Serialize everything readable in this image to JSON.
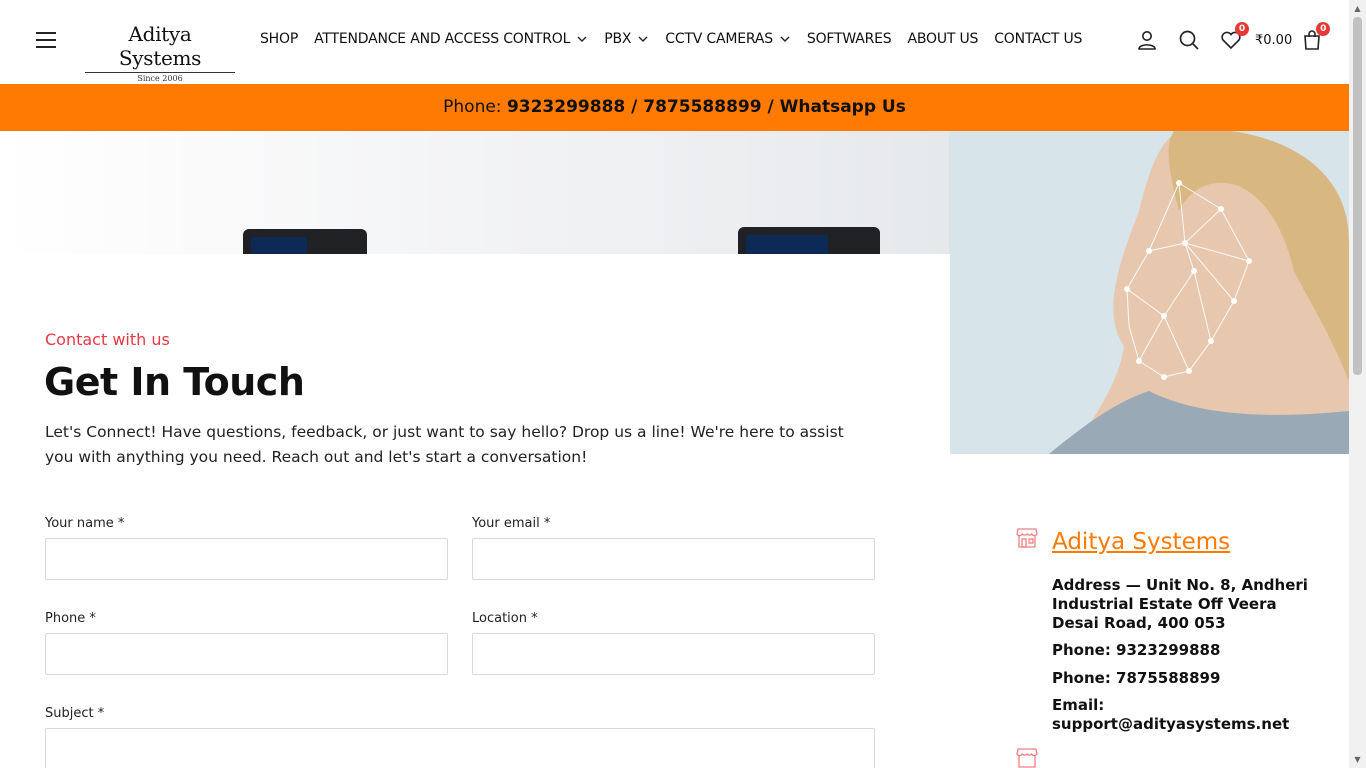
{
  "header": {
    "logo_name": "Aditya Systems",
    "logo_tagline": "Since 2006",
    "nav": [
      {
        "label": "SHOP",
        "has_dropdown": false
      },
      {
        "label": "ATTENDANCE AND ACCESS CONTROL",
        "has_dropdown": true
      },
      {
        "label": "PBX",
        "has_dropdown": true
      },
      {
        "label": "CCTV CAMERAS",
        "has_dropdown": true
      },
      {
        "label": "SOFTWARES",
        "has_dropdown": false
      },
      {
        "label": "ABOUT US",
        "has_dropdown": false
      },
      {
        "label": "CONTACT US",
        "has_dropdown": false
      }
    ],
    "wishlist_count": "0",
    "cart_total": "₹0.00",
    "cart_count": "0",
    "icons": [
      "menu-icon",
      "user-icon",
      "search-icon",
      "heart-icon",
      "shopping-bag-icon"
    ]
  },
  "topbar": {
    "prefix": "Phone: ",
    "phone1": "9323299888",
    "sep1": " / ",
    "phone2": "7875588899",
    "sep2": " / ",
    "whatsapp": "Whatsapp Us",
    "color": "#ff7a00"
  },
  "contact": {
    "eyebrow": "Contact with us",
    "title": "Get In Touch",
    "intro": "Let's Connect! Have questions, feedback, or just want to say hello? Drop us a line! We're here to assist you with anything you need. Reach out and let's start a conversation!",
    "fields": {
      "name": {
        "label": "Your name *",
        "value": ""
      },
      "email": {
        "label": "Your email *",
        "value": ""
      },
      "phone": {
        "label": "Phone *",
        "value": ""
      },
      "location": {
        "label": "Location *",
        "value": ""
      },
      "subject": {
        "label": "Subject *",
        "value": ""
      }
    }
  },
  "card": {
    "company": "Aditya Systems",
    "address": "Address — Unit No. 8, Andheri Industrial Estate Off Veera Desai Road, 400 053",
    "phone1": "Phone: 9323299888",
    "phone2": "Phone: 7875588899",
    "email": "Email: support@adityasystems.net",
    "icon": "store-icon",
    "accent": "#ff7a00"
  }
}
